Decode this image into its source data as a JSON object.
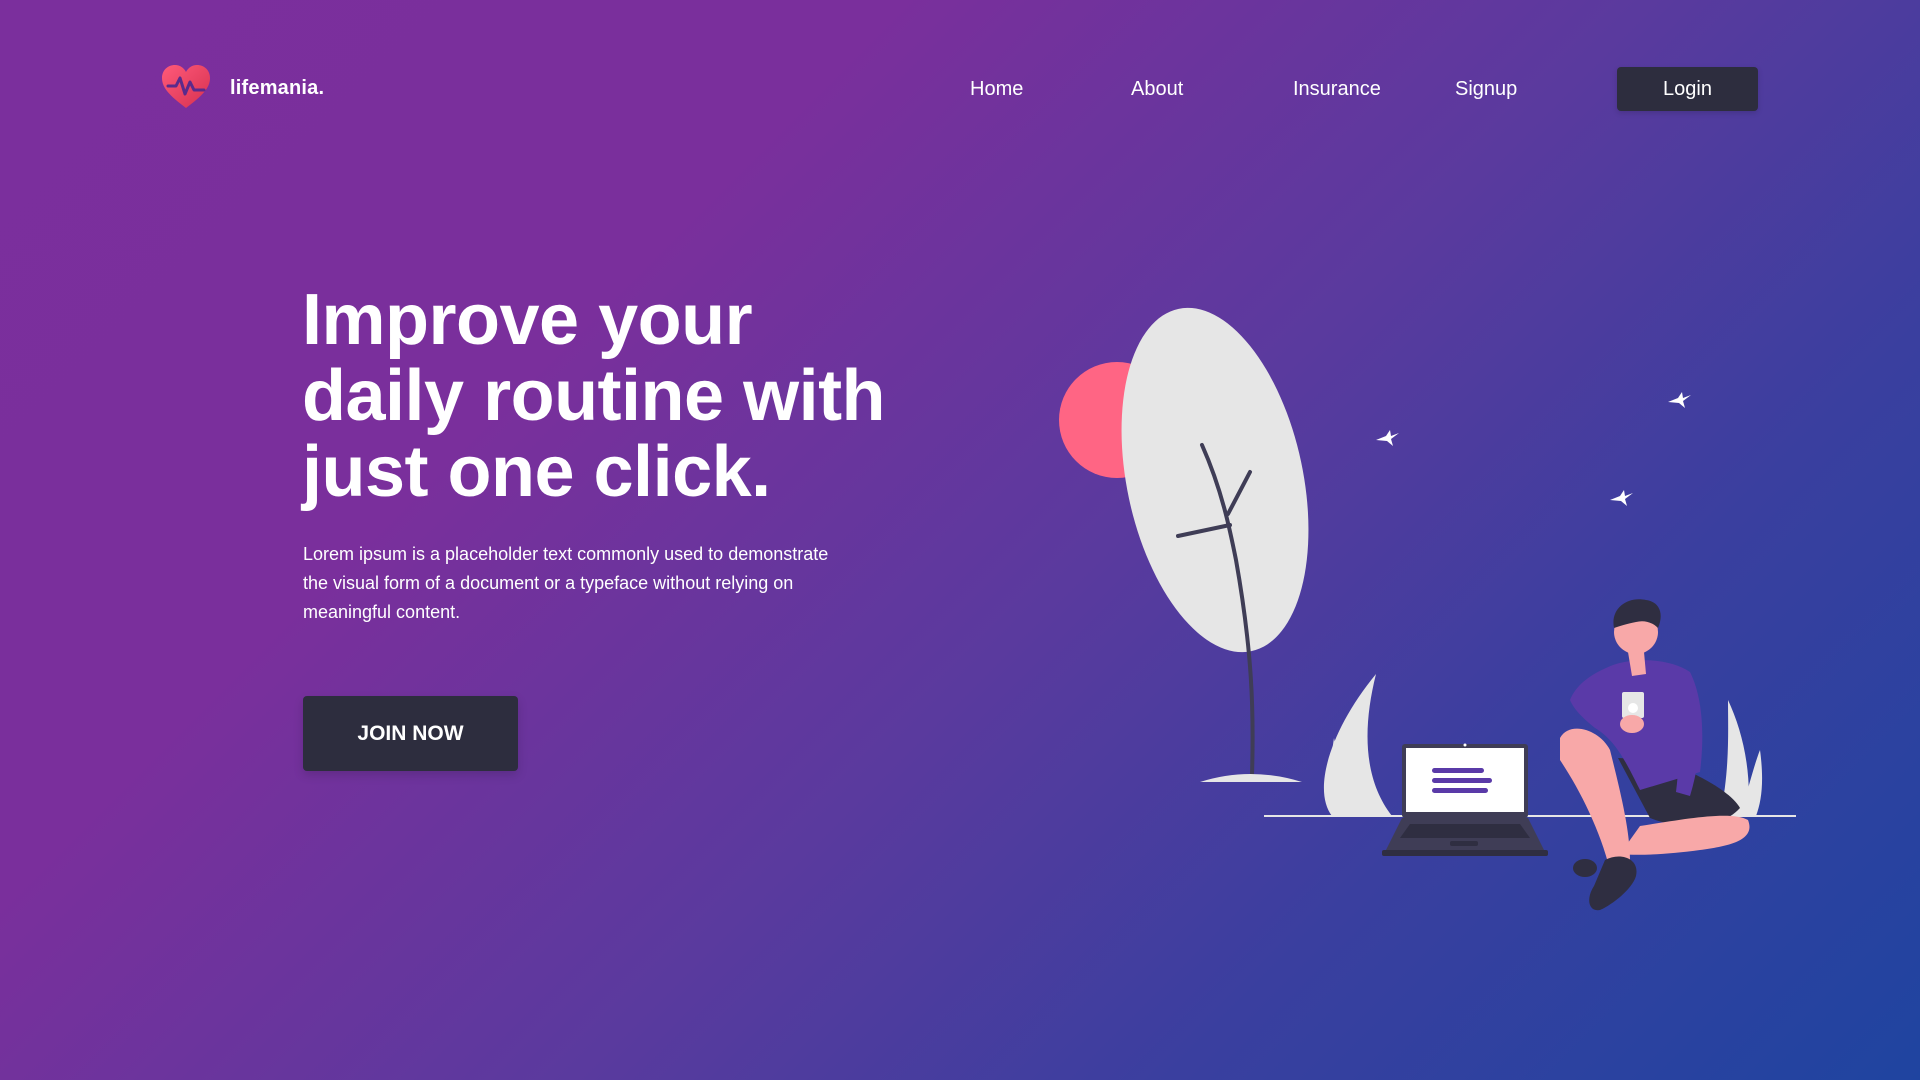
{
  "nav": {
    "brand": "lifemania.",
    "links": {
      "home": "Home",
      "about": "About",
      "insurance": "Insurance",
      "signup": "Signup"
    },
    "login_label": "Login"
  },
  "hero": {
    "title_lines": [
      "Improve your",
      "daily routine with",
      "just one click."
    ],
    "description_lines": [
      "Lorem ipsum is a placeholder text commonly used to demonstrate",
      "the visual form of a document or a typeface without relying on",
      "meaningful content."
    ],
    "cta_label": "JOIN NOW"
  },
  "colors": {
    "background_start": "#7b2f9d",
    "background_end": "#1f44a0",
    "button_dark": "#2d2d3e",
    "accent_pink": "#ff6584",
    "leaf_gray": "#e6e6e6",
    "shirt_purple": "#5a3aa8",
    "skin": "#f8a8a8"
  },
  "icons": {
    "logo": "heart-pulse-icon"
  }
}
